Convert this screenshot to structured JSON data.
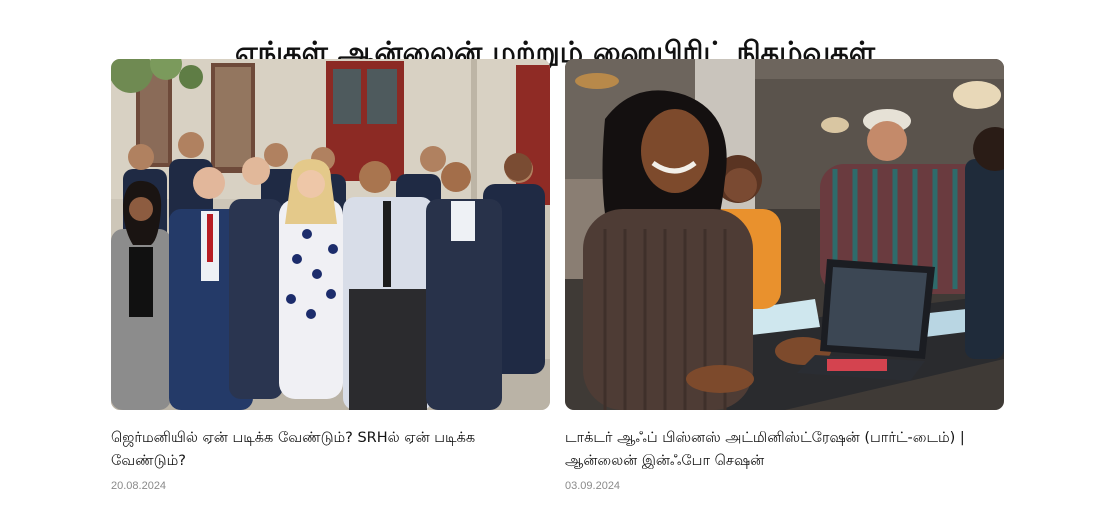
{
  "section": {
    "heading": "எங்கள் ஆன்லைன் மற்றும் ஹைபிரிட் நிகழ்வுகள்"
  },
  "events": [
    {
      "image": "group-of-students-photo",
      "title": "ஜெர்மனியில் ஏன் படிக்க வேண்டும்? SRHல் ஏன் படிக்க வேண்டும்?",
      "date": "20.08.2024"
    },
    {
      "image": "woman-with-laptop-photo",
      "title": "டாக்டர் ஆஃப் பிஸ்னஸ் அட்மினிஸ்ட்ரேஷன் (பார்ட்-டைம்) | ஆன்லைன் இன்ஃபோ செஷன்",
      "date": "03.09.2024"
    }
  ]
}
